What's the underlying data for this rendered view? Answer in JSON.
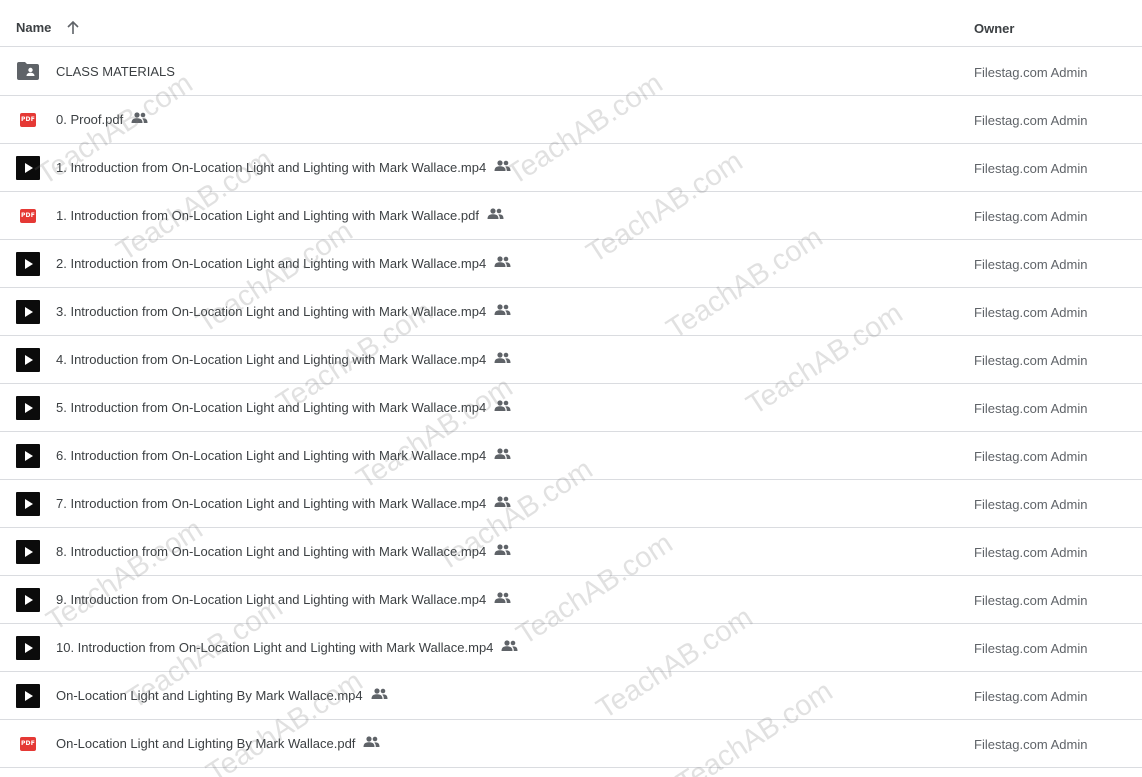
{
  "header": {
    "name_label": "Name",
    "owner_label": "Owner",
    "sort_icon": "arrow-up-icon"
  },
  "files": [
    {
      "name": "CLASS MATERIALS",
      "type": "folder",
      "shared": false,
      "owner": "Filestag.com Admin"
    },
    {
      "name": "0. Proof.pdf",
      "type": "pdf",
      "shared": true,
      "owner": "Filestag.com Admin"
    },
    {
      "name": "1. Introduction from On-Location Light and Lighting with Mark Wallace.mp4",
      "type": "video",
      "shared": true,
      "owner": "Filestag.com Admin"
    },
    {
      "name": "1. Introduction from On-Location Light and Lighting with Mark Wallace.pdf",
      "type": "pdf",
      "shared": true,
      "owner": "Filestag.com Admin"
    },
    {
      "name": "2. Introduction from On-Location Light and Lighting with Mark Wallace.mp4",
      "type": "video",
      "shared": true,
      "owner": "Filestag.com Admin"
    },
    {
      "name": "3. Introduction from On-Location Light and Lighting with Mark Wallace.mp4",
      "type": "video",
      "shared": true,
      "owner": "Filestag.com Admin"
    },
    {
      "name": "4. Introduction from On-Location Light and Lighting with Mark Wallace.mp4",
      "type": "video",
      "shared": true,
      "owner": "Filestag.com Admin"
    },
    {
      "name": "5. Introduction from On-Location Light and Lighting with Mark Wallace.mp4",
      "type": "video",
      "shared": true,
      "owner": "Filestag.com Admin"
    },
    {
      "name": "6. Introduction from On-Location Light and Lighting with Mark Wallace.mp4",
      "type": "video",
      "shared": true,
      "owner": "Filestag.com Admin"
    },
    {
      "name": "7. Introduction from On-Location Light and Lighting with Mark Wallace.mp4",
      "type": "video",
      "shared": true,
      "owner": "Filestag.com Admin"
    },
    {
      "name": "8. Introduction from On-Location Light and Lighting with Mark Wallace.mp4",
      "type": "video",
      "shared": true,
      "owner": "Filestag.com Admin"
    },
    {
      "name": "9. Introduction from On-Location Light and Lighting with Mark Wallace.mp4",
      "type": "video",
      "shared": true,
      "owner": "Filestag.com Admin"
    },
    {
      "name": "10. Introduction from On-Location Light and Lighting with Mark Wallace.mp4",
      "type": "video",
      "shared": true,
      "owner": "Filestag.com Admin"
    },
    {
      "name": "On-Location Light and Lighting By Mark Wallace.mp4",
      "type": "video",
      "shared": true,
      "owner": "Filestag.com Admin"
    },
    {
      "name": "On-Location Light and Lighting By Mark Wallace.pdf",
      "type": "pdf",
      "shared": true,
      "owner": "Filestag.com Admin"
    }
  ],
  "pdf_badge": "PDF",
  "watermark": "TeachAB.com",
  "colors": {
    "pdf": "#e53935",
    "video": "#0b0b0b",
    "folder": "#5f6368",
    "divider": "#dadce0"
  }
}
